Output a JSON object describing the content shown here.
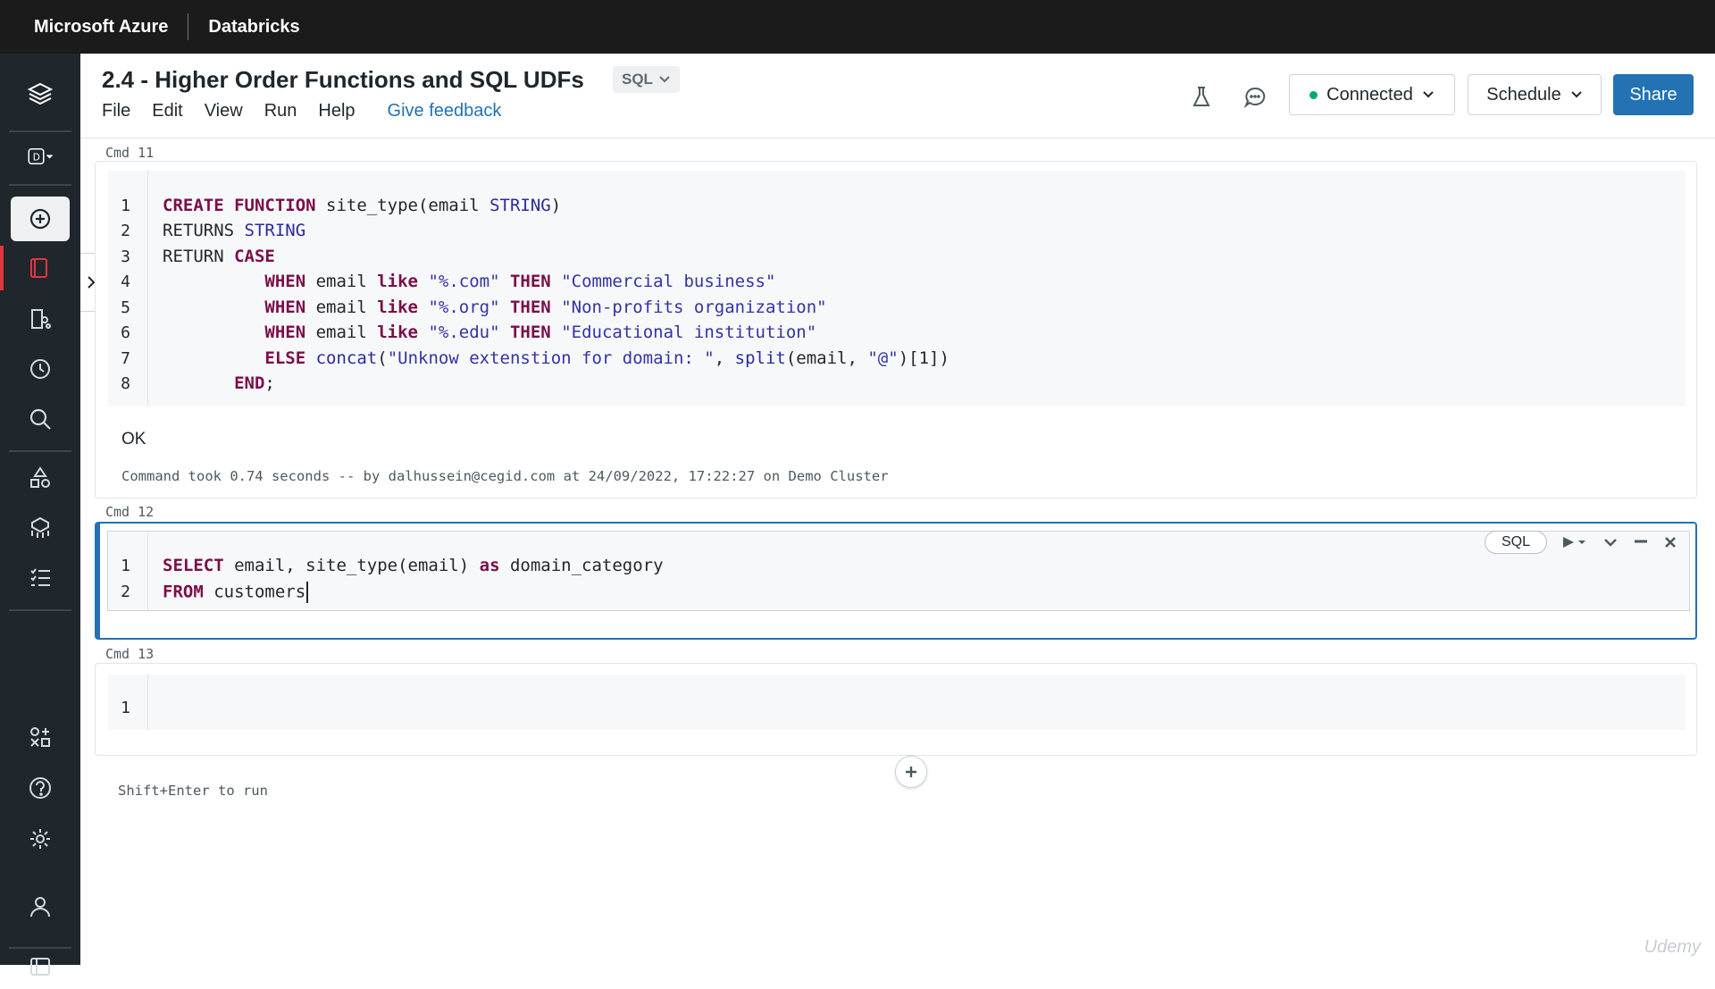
{
  "topbar": {
    "brand": "Microsoft Azure",
    "product": "Databricks"
  },
  "notebook": {
    "title": "2.4 - Higher Order Functions and SQL UDFs",
    "language": "SQL",
    "menu": [
      "File",
      "Edit",
      "View",
      "Run",
      "Help"
    ],
    "feedback": "Give feedback"
  },
  "header_actions": {
    "connected": "Connected",
    "schedule": "Schedule",
    "share": "Share",
    "status_color": "#00a972"
  },
  "sidebar": {
    "icons": [
      "databricks-logo-icon",
      "workspace-switcher-icon",
      "create-icon",
      "workspace-icon",
      "repos-icon",
      "recents-icon",
      "search-icon",
      "data-icon",
      "compute-icon",
      "workflows-icon",
      "partner-connect-icon",
      "help-icon",
      "settings-icon",
      "user-icon",
      "sidebar-toggle-icon"
    ]
  },
  "cells": [
    {
      "label": "Cmd  11",
      "line_numbers": [
        "1",
        "2",
        "3",
        "4",
        "5",
        "6",
        "7",
        "8"
      ],
      "output_ok": "OK",
      "command_took": "Command took 0.74 seconds -- by dalhussein@cegid.com at 24/09/2022, 17:22:27 on Demo Cluster"
    },
    {
      "label": "Cmd  12",
      "line_numbers": [
        "1",
        "2"
      ],
      "language": "SQL"
    },
    {
      "label": "Cmd  13",
      "line_numbers": [
        "1"
      ]
    }
  ],
  "hint": "Shift+Enter to run",
  "watermark": "Udemy",
  "colors": {
    "share": "#2272b4",
    "topbar": "#1b1b1b",
    "sidebar": "#1f272d",
    "keyword": "#7a0f4a"
  }
}
